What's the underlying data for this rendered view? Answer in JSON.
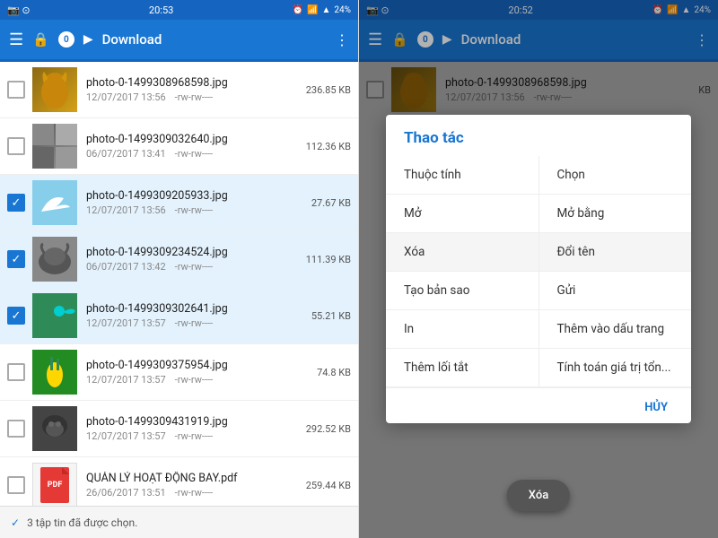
{
  "left": {
    "status_bar": {
      "time": "20:53",
      "battery": "24%"
    },
    "toolbar": {
      "badge": "0",
      "title": "Download",
      "more_icon": "⋮"
    },
    "files": [
      {
        "name": "photo-0-1499308968598.jpg",
        "date": "12/07/2017 13:56",
        "perms": "-rw-rw----",
        "size": "236.85 KB",
        "checked": false,
        "thumb": "lion"
      },
      {
        "name": "photo-0-1499309032640.jpg",
        "date": "06/07/2017 13:41",
        "perms": "-rw-rw----",
        "size": "112.36 KB",
        "checked": false,
        "thumb": "collage"
      },
      {
        "name": "photo-0-1499309205933.jpg",
        "date": "12/07/2017 13:56",
        "perms": "-rw-rw----",
        "size": "27.67 KB",
        "checked": true,
        "thumb": "bird"
      },
      {
        "name": "photo-0-1499309234524.jpg",
        "date": "06/07/2017 13:42",
        "perms": "-rw-rw----",
        "size": "111.39 KB",
        "checked": true,
        "thumb": "buffalo"
      },
      {
        "name": "photo-0-1499309302641.jpg",
        "date": "12/07/2017 13:57",
        "perms": "-rw-rw----",
        "size": "55.21 KB",
        "checked": true,
        "thumb": "hummingbird"
      },
      {
        "name": "photo-0-1499309375954.jpg",
        "date": "12/07/2017 13:57",
        "perms": "-rw-rw----",
        "size": "74.8 KB",
        "checked": false,
        "thumb": "corn"
      },
      {
        "name": "photo-0-1499309431919.jpg",
        "date": "12/07/2017 13:57",
        "perms": "-rw-rw----",
        "size": "292.52 KB",
        "checked": false,
        "thumb": "gorilla"
      },
      {
        "name": "QUẢN LÝ HOẠT ĐỘNG BAY.pdf",
        "date": "26/06/2017 13:51",
        "perms": "-rw-rw----",
        "size": "259.44 KB",
        "checked": false,
        "thumb": "pdf"
      }
    ],
    "bottom_bar": "3 tập tin đã được chọn."
  },
  "right": {
    "status_bar": {
      "time": "20:52",
      "battery": "24%"
    },
    "toolbar": {
      "badge": "0",
      "title": "Download"
    },
    "dialog": {
      "title": "Thao tác",
      "rows": [
        {
          "left": "Thuộc tính",
          "right": "Chọn"
        },
        {
          "left": "Mở",
          "right": "Mở bằng"
        },
        {
          "left": "Xóa",
          "right": "Đổi tên",
          "highlighted": true
        },
        {
          "left": "Tạo bản sao",
          "right": "Gửi"
        },
        {
          "left": "In",
          "right": "Thêm vào dấu trang"
        },
        {
          "left": "Thêm lối tắt",
          "right": "Tính toán giá trị tổn..."
        }
      ],
      "cancel_label": "HỦY",
      "fab_label": "Xóa"
    }
  }
}
